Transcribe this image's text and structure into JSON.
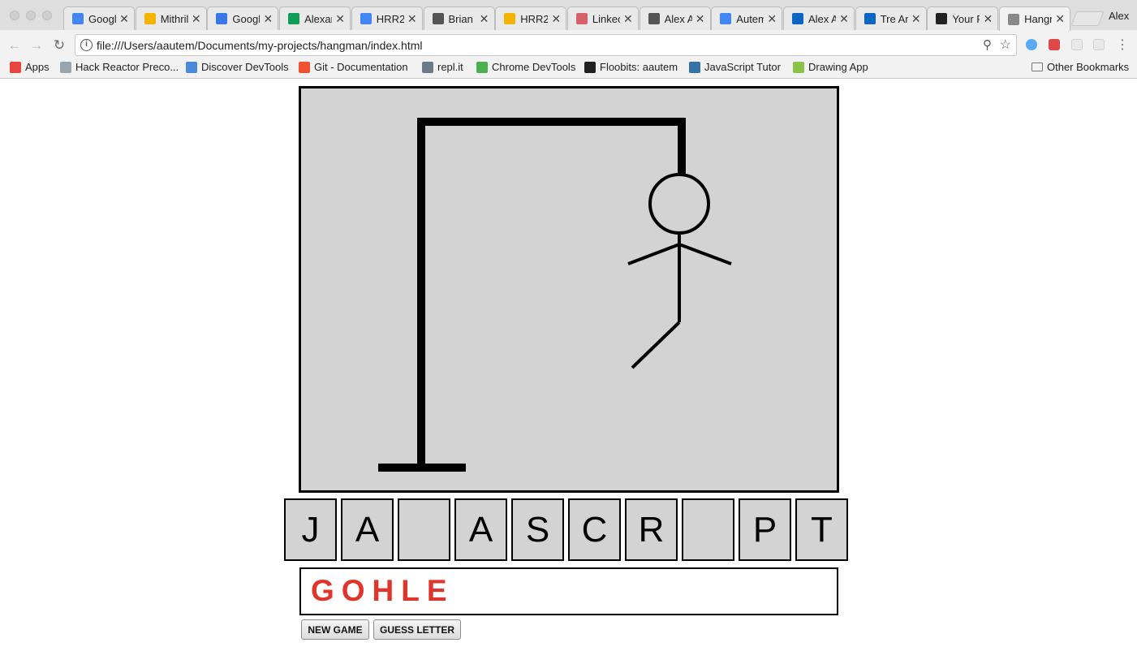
{
  "browser": {
    "tabs": [
      {
        "title": "Googl",
        "icon": "google-icon",
        "color": "#4285f4"
      },
      {
        "title": "Mithril",
        "icon": "slides-icon",
        "color": "#f4b400"
      },
      {
        "title": "Googl",
        "icon": "calendar-icon",
        "color": "#3b78e7"
      },
      {
        "title": "Alexar",
        "icon": "drive-icon",
        "color": "#0f9d58"
      },
      {
        "title": "HRR2",
        "icon": "docs-icon",
        "color": "#4285f4"
      },
      {
        "title": "Brian",
        "icon": "peace-hand-icon",
        "color": "#555555"
      },
      {
        "title": "HRR2",
        "icon": "slides-icon",
        "color": "#f4b400"
      },
      {
        "title": "Linkec",
        "icon": "s-icon",
        "color": "#d6616b"
      },
      {
        "title": "Alex A",
        "icon": "peace-hand-icon",
        "color": "#555555"
      },
      {
        "title": "Autem",
        "icon": "docs-icon",
        "color": "#4285f4"
      },
      {
        "title": "Alex A",
        "icon": "linkedin-icon",
        "color": "#0a66c2"
      },
      {
        "title": "Tre Ar",
        "icon": "linkedin-icon",
        "color": "#0a66c2"
      },
      {
        "title": "Your P",
        "icon": "github-icon",
        "color": "#222222"
      },
      {
        "title": "Hangn",
        "icon": "page-icon",
        "color": "#888888",
        "active": true
      }
    ],
    "profile_name": "Alex",
    "url": "file:///Users/aautem/Documents/my-projects/hangman/index.html",
    "bookmarks": [
      {
        "label": "Apps",
        "icon": "apps-grid-icon"
      },
      {
        "label": "Hack Reactor Preco...",
        "icon": "globe-icon"
      },
      {
        "label": "Discover DevTools",
        "icon": "devtools-icon"
      },
      {
        "label": "Git - Documentation",
        "icon": "git-icon"
      },
      {
        "label": "repl.it",
        "icon": "replit-icon"
      },
      {
        "label": "Chrome DevTools",
        "icon": "chrome-devtools-icon"
      },
      {
        "label": "Floobits: aautem",
        "icon": "floobits-icon"
      },
      {
        "label": "JavaScript Tutor",
        "icon": "python-icon"
      },
      {
        "label": "Drawing App",
        "icon": "w-icon"
      }
    ],
    "other_bookmarks": "Other Bookmarks"
  },
  "game": {
    "word_slots": [
      "J",
      "A",
      "",
      "A",
      "S",
      "C",
      "R",
      "",
      "P",
      "T"
    ],
    "wrong_guesses": "GOHLE",
    "buttons": {
      "new_game": "NEW GAME",
      "guess_letter": "GUESS LETTER"
    },
    "colors": {
      "stage": "#d3d3d3",
      "wrong_letters": "#e0352b"
    }
  }
}
